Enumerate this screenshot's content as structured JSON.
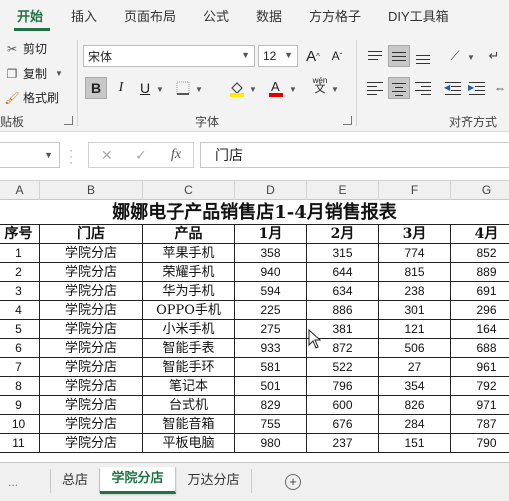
{
  "ribbon": {
    "tabs": [
      "开始",
      "插入",
      "页面布局",
      "公式",
      "数据",
      "方方格子",
      "DIY工具箱"
    ],
    "clipboard": {
      "cut": "剪切",
      "copy": "复制",
      "format_painter": "格式刷",
      "group_label": "贴板"
    },
    "font": {
      "name": "宋体",
      "size": "12",
      "bold": "B",
      "italic": "I",
      "underline": "U",
      "grow": "A",
      "shrink": "A",
      "group_label": "字体",
      "phonetic": "wén"
    },
    "alignment": {
      "group_label": "对齐方式"
    }
  },
  "formula_bar": {
    "cancel": "✕",
    "enter": "✓",
    "fx": "fx",
    "content": "门店"
  },
  "columns": [
    "A",
    "B",
    "C",
    "D",
    "E",
    "F",
    "G"
  ],
  "sheet": {
    "title": "娜娜电子产品销售店1-4月销售报表",
    "headers": [
      "序号",
      "门店",
      "产品",
      "1月",
      "2月",
      "3月",
      "4月"
    ],
    "rows": [
      [
        "1",
        "学院分店",
        "苹果手机",
        "358",
        "315",
        "774",
        "852"
      ],
      [
        "2",
        "学院分店",
        "荣耀手机",
        "940",
        "644",
        "815",
        "889"
      ],
      [
        "3",
        "学院分店",
        "华为手机",
        "594",
        "634",
        "238",
        "691"
      ],
      [
        "4",
        "学院分店",
        "OPPO手机",
        "225",
        "886",
        "301",
        "296"
      ],
      [
        "5",
        "学院分店",
        "小米手机",
        "275",
        "381",
        "121",
        "164"
      ],
      [
        "6",
        "学院分店",
        "智能手表",
        "933",
        "872",
        "506",
        "688"
      ],
      [
        "7",
        "学院分店",
        "智能手环",
        "581",
        "522",
        "27",
        "961"
      ],
      [
        "8",
        "学院分店",
        "笔记本",
        "501",
        "796",
        "354",
        "792"
      ],
      [
        "9",
        "学院分店",
        "台式机",
        "829",
        "600",
        "826",
        "971"
      ],
      [
        "10",
        "学院分店",
        "智能音箱",
        "755",
        "676",
        "284",
        "787"
      ],
      [
        "11",
        "学院分店",
        "平板电脑",
        "980",
        "237",
        "151",
        "790"
      ]
    ]
  },
  "sheet_tabs": {
    "ellipsis": "...",
    "tabs": [
      "总店",
      "学院分店",
      "万达分店"
    ],
    "active": "学院分店",
    "add": "+"
  },
  "colors": {
    "accent": "#217346",
    "highlight": "#ffeb00",
    "font_red": "#e00000"
  }
}
